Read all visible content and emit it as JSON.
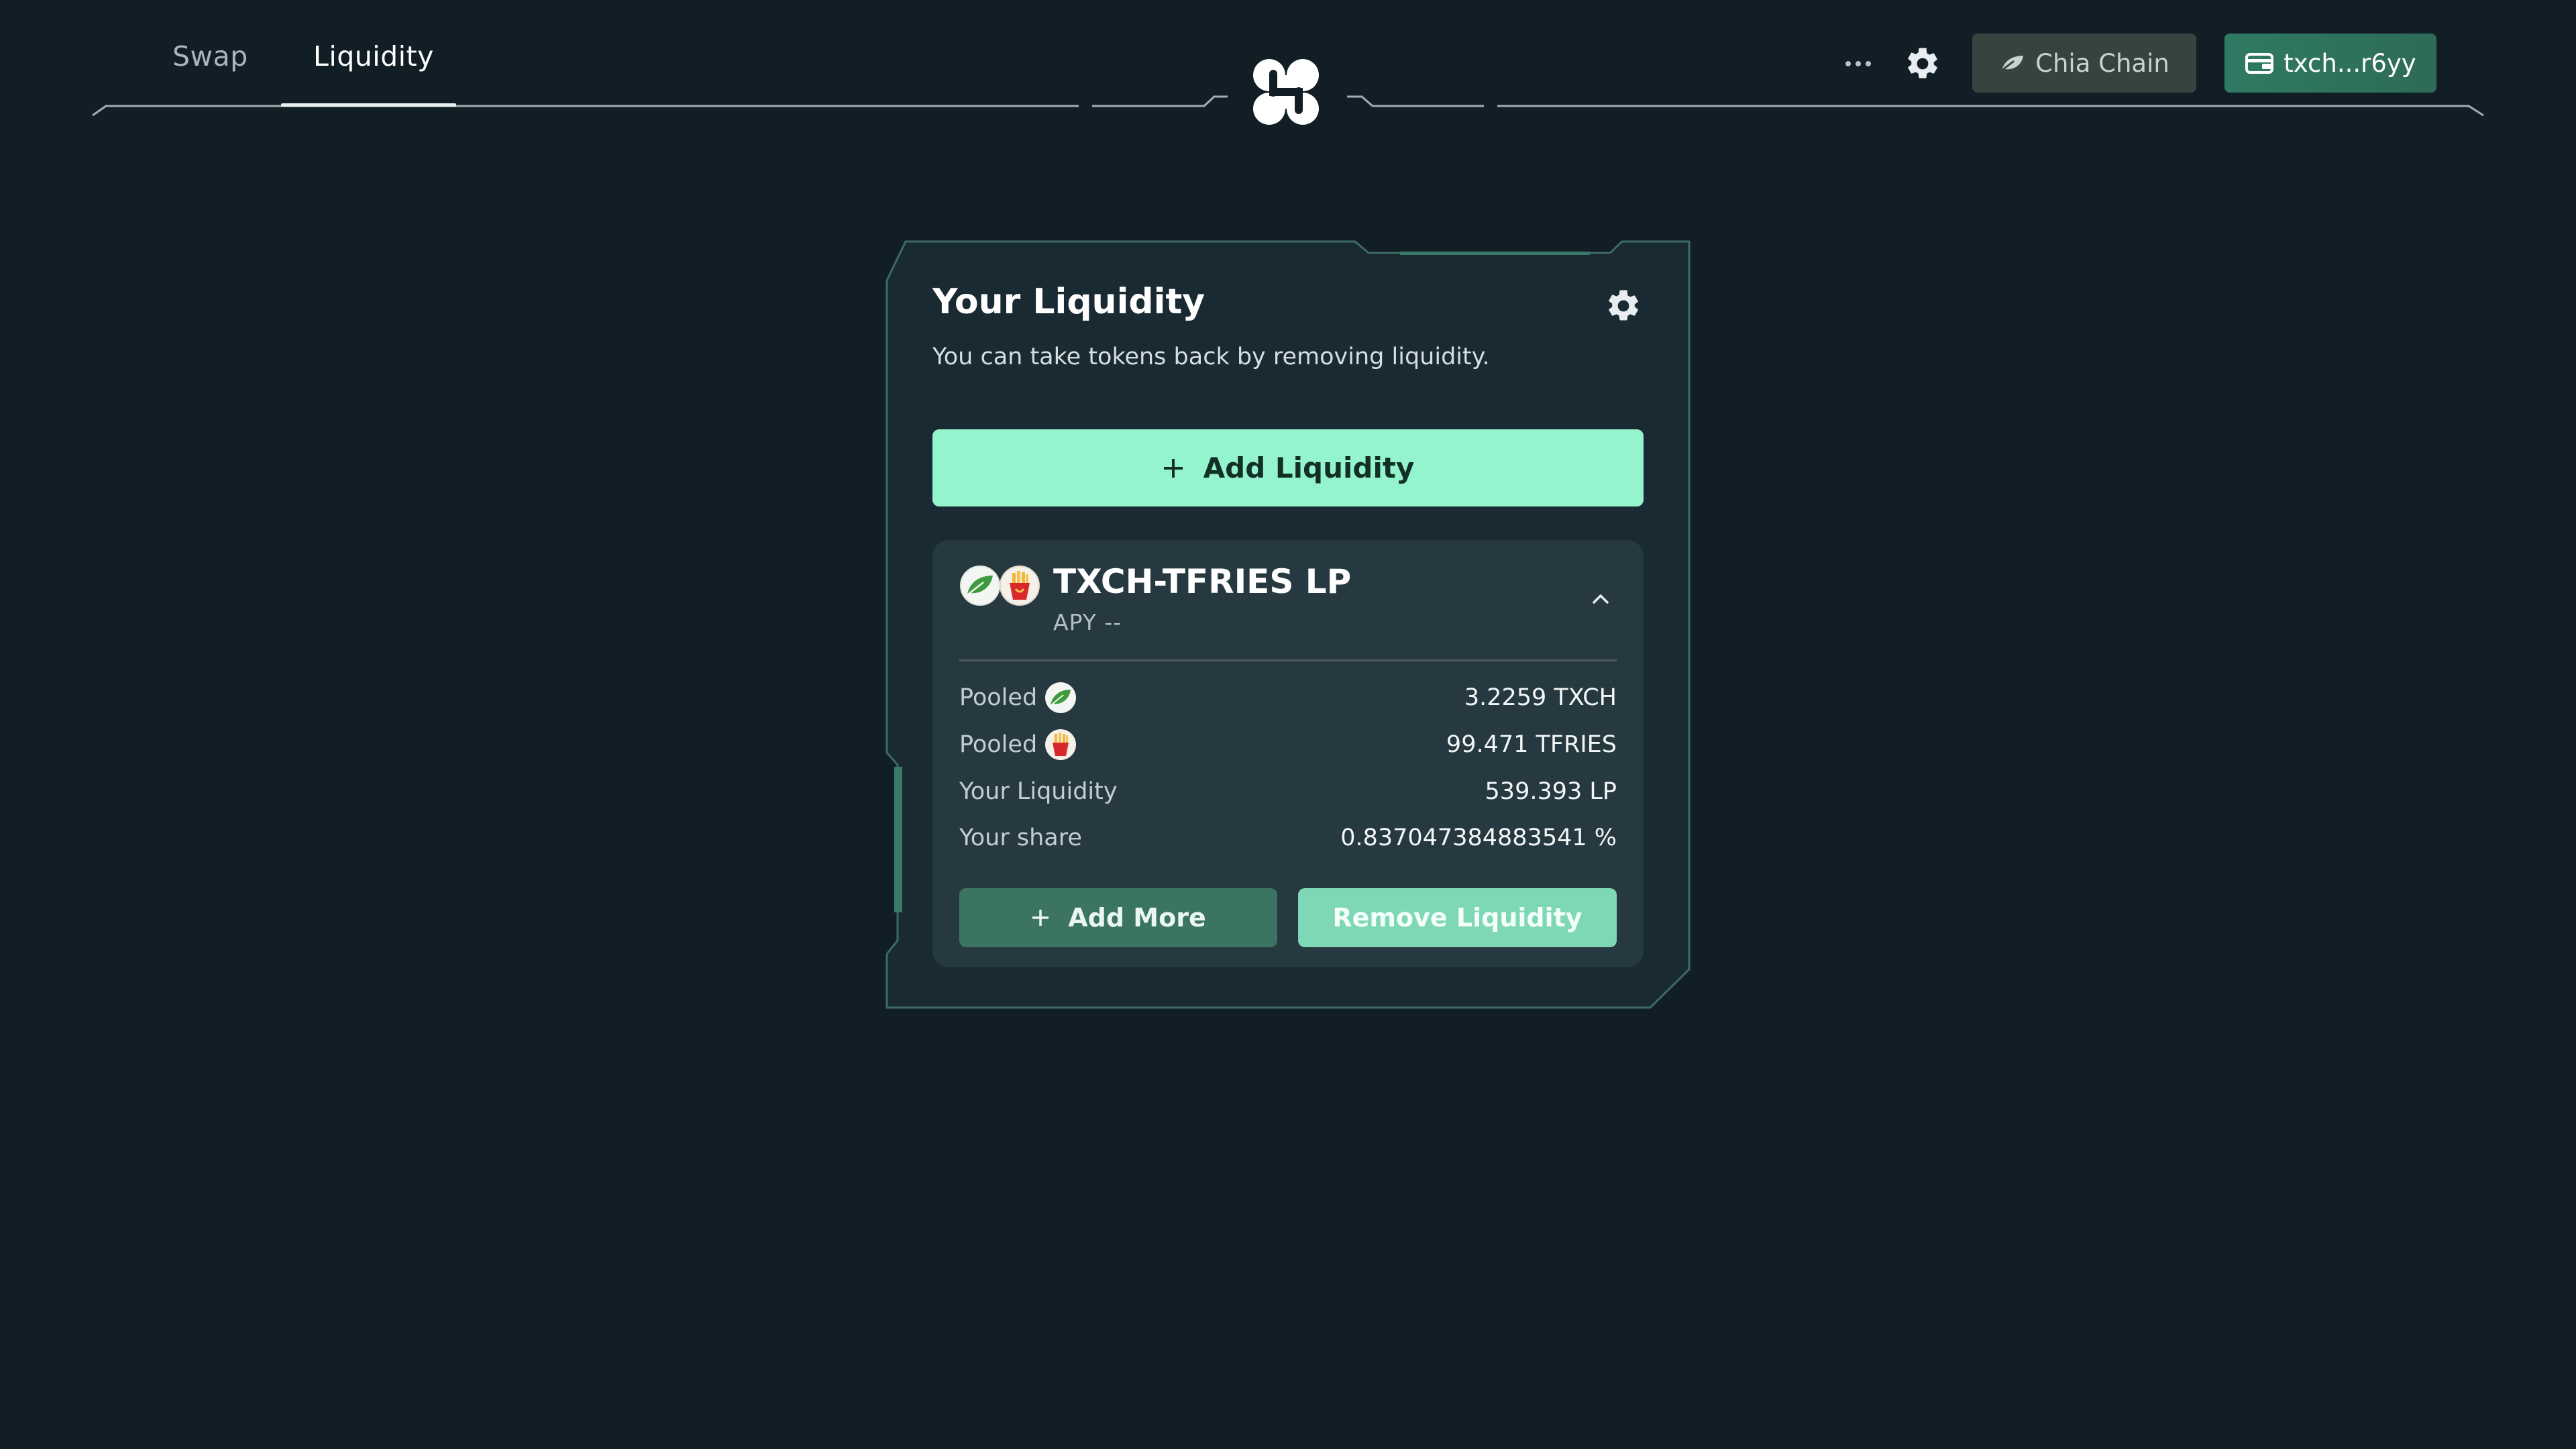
{
  "nav": {
    "tabs": [
      {
        "label": "Swap"
      },
      {
        "label": "Liquidity"
      }
    ],
    "active_tab": "Liquidity"
  },
  "header": {
    "chain_label": "Chia Chain",
    "wallet_label": "txch...r6yy"
  },
  "card": {
    "title": "Your Liquidity",
    "subtitle": "You can take tokens back by removing liquidity.",
    "add_liquidity_label": "Add Liquidity"
  },
  "pool": {
    "name": "TXCH-TFRIES LP",
    "apy": "APY --",
    "rows": [
      {
        "label": "Pooled",
        "value": "3.2259 TXCH",
        "icon": "chia-leaf-icon"
      },
      {
        "label": "Pooled",
        "value": "99.471 TFRIES",
        "icon": "fries-icon"
      },
      {
        "label": "Your Liquidity",
        "value": "539.393 LP"
      },
      {
        "label": "Your share",
        "value": "0.837047384883541 %"
      }
    ],
    "add_more_label": "Add More",
    "remove_label": "Remove Liquidity"
  },
  "colors": {
    "background": "#121e25",
    "accent": "#93f4cd",
    "wallet": "#2f7a63"
  }
}
